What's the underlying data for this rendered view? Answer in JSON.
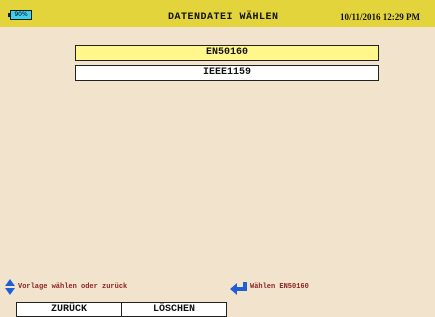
{
  "header": {
    "battery_label": "90%",
    "title": "DATENDATEI WÄHLEN",
    "datetime": "10/11/2016 12:29 PM"
  },
  "files": [
    {
      "label": "EN50160",
      "selected": true
    },
    {
      "label": "IEEE1159",
      "selected": false
    }
  ],
  "hints": {
    "navigate": "Vorlage wählen oder zurück",
    "enter": "Wählen EN50160"
  },
  "function_keys": {
    "back": "ZURÜCK",
    "delete": "LÖSCHEN"
  },
  "colors": {
    "header_bar": "#e2d43a",
    "background": "#f2e4cc",
    "selected_item": "#fff68c",
    "hint_text": "#8a1f1f",
    "icon_blue": "#1f5fd6"
  },
  "icons": {
    "battery": "battery-icon",
    "navigate": "up-down-arrow-icon",
    "enter": "enter-key-icon"
  }
}
